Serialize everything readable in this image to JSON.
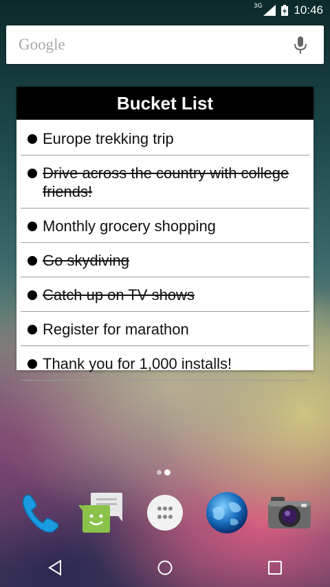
{
  "status_bar": {
    "network": "3G",
    "time": "10:46",
    "icons": [
      "signal-icon",
      "battery-icon"
    ]
  },
  "search": {
    "logo_text": "Google",
    "mic_icon": "microphone-icon"
  },
  "widget": {
    "title": "Bucket List",
    "items": [
      {
        "text": "Europe trekking trip",
        "done": false
      },
      {
        "text": "Drive across the country with college friends!",
        "done": true
      },
      {
        "text": "Monthly grocery shopping",
        "done": false
      },
      {
        "text": "Go skydiving",
        "done": true
      },
      {
        "text": "Catch up on TV shows",
        "done": true
      },
      {
        "text": "Register for marathon",
        "done": false
      },
      {
        "text": "Thank you for 1,000 installs!",
        "done": false
      }
    ]
  },
  "home": {
    "pages": 2,
    "current_page": 2
  },
  "dock": {
    "apps": [
      "phone-icon",
      "messaging-icon",
      "app-drawer-icon",
      "browser-globe-icon",
      "camera-icon"
    ]
  },
  "nav": {
    "buttons": [
      "back-icon",
      "home-icon",
      "recents-icon"
    ]
  },
  "colors": {
    "widget_header": "#000000",
    "phone_blue": "#1a9ae0",
    "messaging_green": "#8bc34a"
  }
}
